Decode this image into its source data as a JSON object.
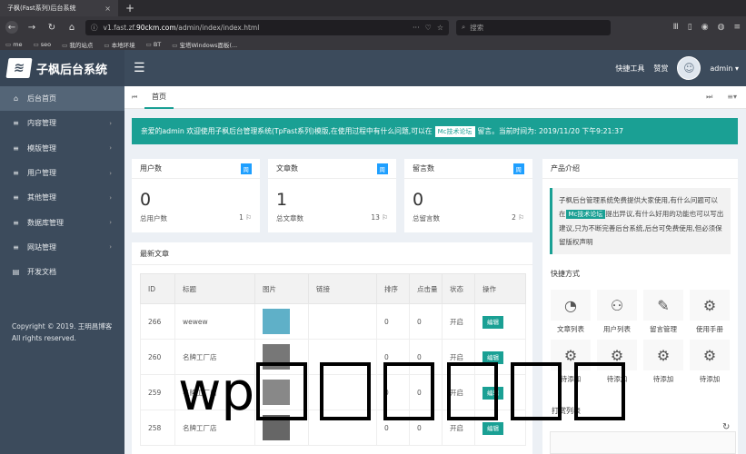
{
  "browser": {
    "tab_title": "子枫(Fast系列)后台系统",
    "tab_close": "×",
    "new_tab": "+",
    "url_prefix": "v1.fast.zf.",
    "url_host": "90ckm.com",
    "url_path": "/admin/index/index.html",
    "url_dots": "···",
    "search_placeholder": "搜索",
    "bookmarks": [
      "me",
      "seo",
      "我的站点",
      "本地环境",
      "BT",
      "宝塔Windows面板(..."
    ]
  },
  "header": {
    "logo_text": "子枫后台系统",
    "quick_tools": "快捷工具",
    "like": "赞赏",
    "user": "admin ▾"
  },
  "sidebar": {
    "items": [
      {
        "label": "后台首页",
        "icon": "⌂",
        "arrow": ""
      },
      {
        "label": "内容管理",
        "icon": "≡",
        "arrow": "›"
      },
      {
        "label": "模版管理",
        "icon": "≡",
        "arrow": "›"
      },
      {
        "label": "用户管理",
        "icon": "≡",
        "arrow": "›"
      },
      {
        "label": "其他管理",
        "icon": "≡",
        "arrow": "›"
      },
      {
        "label": "数据库管理",
        "icon": "≡",
        "arrow": "›"
      },
      {
        "label": "网站管理",
        "icon": "≡",
        "arrow": "›"
      },
      {
        "label": "开发文档",
        "icon": "▤",
        "arrow": ""
      }
    ],
    "copyright_line1": "Copyright © 2019. 王明昌博客",
    "copyright_line2": "All rights reserved."
  },
  "tabstrip": {
    "home": "首页"
  },
  "notice": {
    "text_before": "亲爱的admin 欢迎使用子枫后台管理系统(TpFast系列)模版,在使用过程中有什么问题,可以在",
    "tag": "Mc技术论坛",
    "text_after": "留言。当前时间为: 2019/11/20 下午9:21:37"
  },
  "stats": [
    {
      "title": "用户数",
      "badge": "周",
      "value": "0",
      "footer": "总用户数",
      "count": "1"
    },
    {
      "title": "文章数",
      "badge": "周",
      "value": "1",
      "footer": "总文章数",
      "count": "13"
    },
    {
      "title": "留言数",
      "badge": "周",
      "value": "0",
      "footer": "总留言数",
      "count": "2"
    }
  ],
  "posts": {
    "title": "最新文章",
    "columns": [
      "ID",
      "标题",
      "图片",
      "链接",
      "排序",
      "点击量",
      "状态",
      "操作"
    ],
    "rows": [
      {
        "id": "266",
        "title": "wewew",
        "link": "",
        "sort": "0",
        "clicks": "0",
        "status": "开启",
        "action": "编辑",
        "thumb": "#5fb0c8"
      },
      {
        "id": "260",
        "title": "名牌工厂店",
        "link": "",
        "sort": "0",
        "clicks": "0",
        "status": "开启",
        "action": "编辑",
        "thumb": "#777"
      },
      {
        "id": "259",
        "title": "名牌工厂店",
        "link": "",
        "sort": "0",
        "clicks": "0",
        "status": "开启",
        "action": "编辑",
        "thumb": "#888"
      },
      {
        "id": "258",
        "title": "名牌工厂店",
        "link": "",
        "sort": "0",
        "clicks": "0",
        "status": "开启",
        "action": "编辑",
        "thumb": "#666"
      }
    ]
  },
  "product": {
    "title": "产品介绍",
    "text_before": "子枫后台管理系统免费提供大家使用,有什么问题可以在",
    "tag": "Mc技术论坛",
    "text_after": "提出异议,有什么好用的功能也可以写出建议,只为不断完善后台系统,后台可免费使用,但必须保留版权声明"
  },
  "quick": {
    "title": "快捷方式",
    "items": [
      {
        "label": "文章列表",
        "icon": "◔"
      },
      {
        "label": "用户列表",
        "icon": "⚇"
      },
      {
        "label": "留言管理",
        "icon": "✎"
      },
      {
        "label": "使用手册",
        "icon": "⚙"
      },
      {
        "label": "待添加",
        "icon": "⚙"
      },
      {
        "label": "待添加",
        "icon": "⚙"
      },
      {
        "label": "待添加",
        "icon": "⚙"
      },
      {
        "label": "待添加",
        "icon": "⚙"
      }
    ]
  },
  "print_list": {
    "title": "打赏列表"
  },
  "overlay_text": "wp"
}
